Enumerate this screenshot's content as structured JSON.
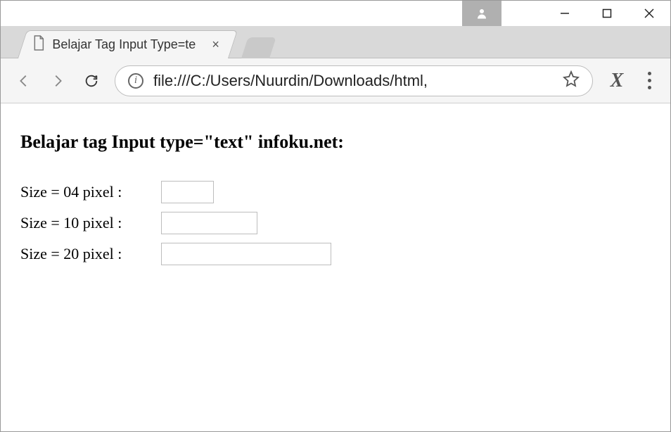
{
  "window": {
    "minimize_title": "Minimize",
    "maximize_title": "Maximize",
    "close_title": "Close"
  },
  "tab": {
    "title": "Belajar Tag Input Type=te",
    "close_label": "×"
  },
  "toolbar": {
    "back_title": "Back",
    "forward_title": "Forward",
    "reload_title": "Reload",
    "info_title": "View site information",
    "star_title": "Bookmark this page",
    "ext_label": "X",
    "menu_title": "Customize and control"
  },
  "address": {
    "url": "file:///C:/Users/Nuurdin/Downloads/html,"
  },
  "page": {
    "heading": "Belajar tag Input type=\"text\" infoku.net:",
    "rows": [
      {
        "label": "Size = 04 pixel :",
        "size": 4
      },
      {
        "label": "Size = 10 pixel :",
        "size": 10
      },
      {
        "label": "Size = 20 pixel :",
        "size": 20
      }
    ]
  }
}
